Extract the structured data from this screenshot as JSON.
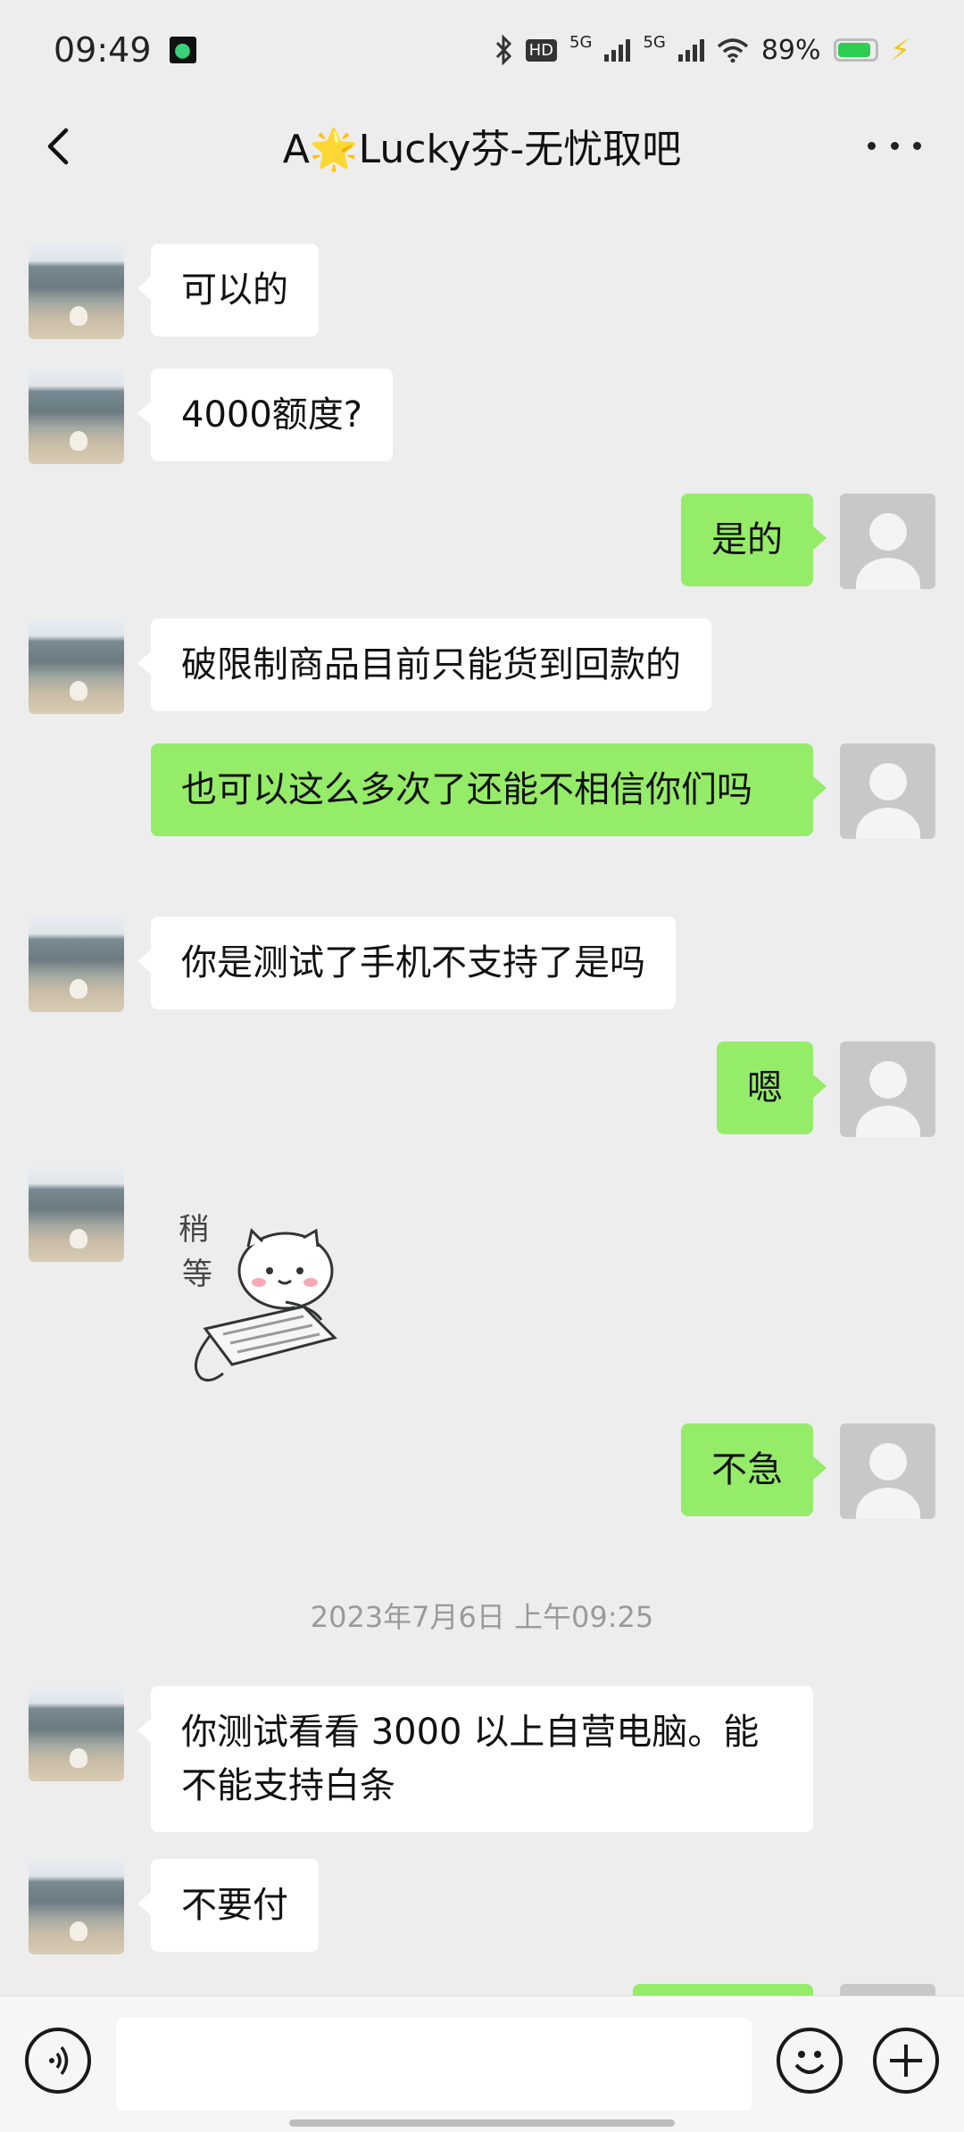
{
  "status_bar": {
    "time": "09:49",
    "network_1": "5G",
    "network_2": "5G",
    "hd_label": "HD",
    "battery_percent": "89%",
    "battery_level": 0.89,
    "icons": [
      "app-badge-icon",
      "bluetooth-icon",
      "hd-icon",
      "signal-icon",
      "wifi-icon",
      "battery-icon",
      "charging-icon"
    ]
  },
  "header": {
    "title": "A🌟Lucky芬-无忧取吧",
    "back_icon": "chevron-left-icon",
    "more_icon": "more-dots-icon"
  },
  "messages": [
    {
      "from": "peer",
      "text": "可以的"
    },
    {
      "from": "peer",
      "text": "4000额度?"
    },
    {
      "from": "me",
      "text": "是的"
    },
    {
      "from": "peer",
      "text": "破限制商品目前只能货到回款的"
    },
    {
      "from": "me",
      "text": "也可以这么多次了还能不相信你们吗"
    },
    {
      "from": "peer",
      "text": "你是测试了手机不支持了是吗"
    },
    {
      "from": "me",
      "text": "嗯"
    },
    {
      "from": "peer",
      "type": "sticker",
      "text": "稍等"
    },
    {
      "from": "me",
      "text": "不急"
    },
    {
      "from": "peer",
      "text": "你测试看看 3000 以上自营电脑。能不能支持白条"
    },
    {
      "from": "peer",
      "text": "不要付"
    }
  ],
  "timestamp": "2023年7月6日 上午09:25",
  "input_bar": {
    "voice_icon": "voice-icon",
    "emoji_icon": "emoji-icon",
    "plus_icon": "plus-icon",
    "text_value": ""
  },
  "colors": {
    "background": "#ededed",
    "my_bubble": "#95ec69",
    "peer_bubble": "#ffffff",
    "battery": "#2fcc52"
  }
}
